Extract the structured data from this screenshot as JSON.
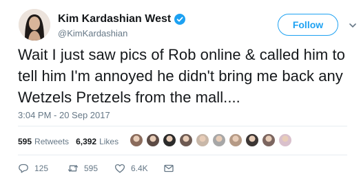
{
  "user": {
    "display_name": "Kim Kardashian West",
    "handle": "@KimKardashian",
    "verified": true,
    "avatar_icon": "profile-photo"
  },
  "header": {
    "follow_label": "Follow",
    "caret_icon": "chevron-down-icon"
  },
  "tweet": {
    "text": "Wait I just saw pics of Rob online & called him to tell him I'm annoyed he didn't bring me back any Wetzels Pretzels from the mall....",
    "timestamp": "3:04 PM - 20 Sep 2017"
  },
  "stats": {
    "retweets_count": "595",
    "retweets_label": "Retweets",
    "likes_count": "6,392",
    "likes_label": "Likes"
  },
  "likers": [
    {
      "color": "#8a6b5c"
    },
    {
      "color": "#5c4a44"
    },
    {
      "color": "#2b2b2b"
    },
    {
      "color": "#6d5a52"
    },
    {
      "color": "#c8b7a8"
    },
    {
      "color": "#a7a7a7"
    },
    {
      "color": "#b59a86"
    },
    {
      "color": "#3c3634"
    },
    {
      "color": "#7c6660"
    },
    {
      "color": "#d9c0cc"
    }
  ],
  "actions": {
    "reply_count": "125",
    "retweet_count": "595",
    "like_count": "6.4K"
  },
  "colors": {
    "accent": "#1da1f2",
    "muted": "#657786",
    "text": "#14171a"
  }
}
